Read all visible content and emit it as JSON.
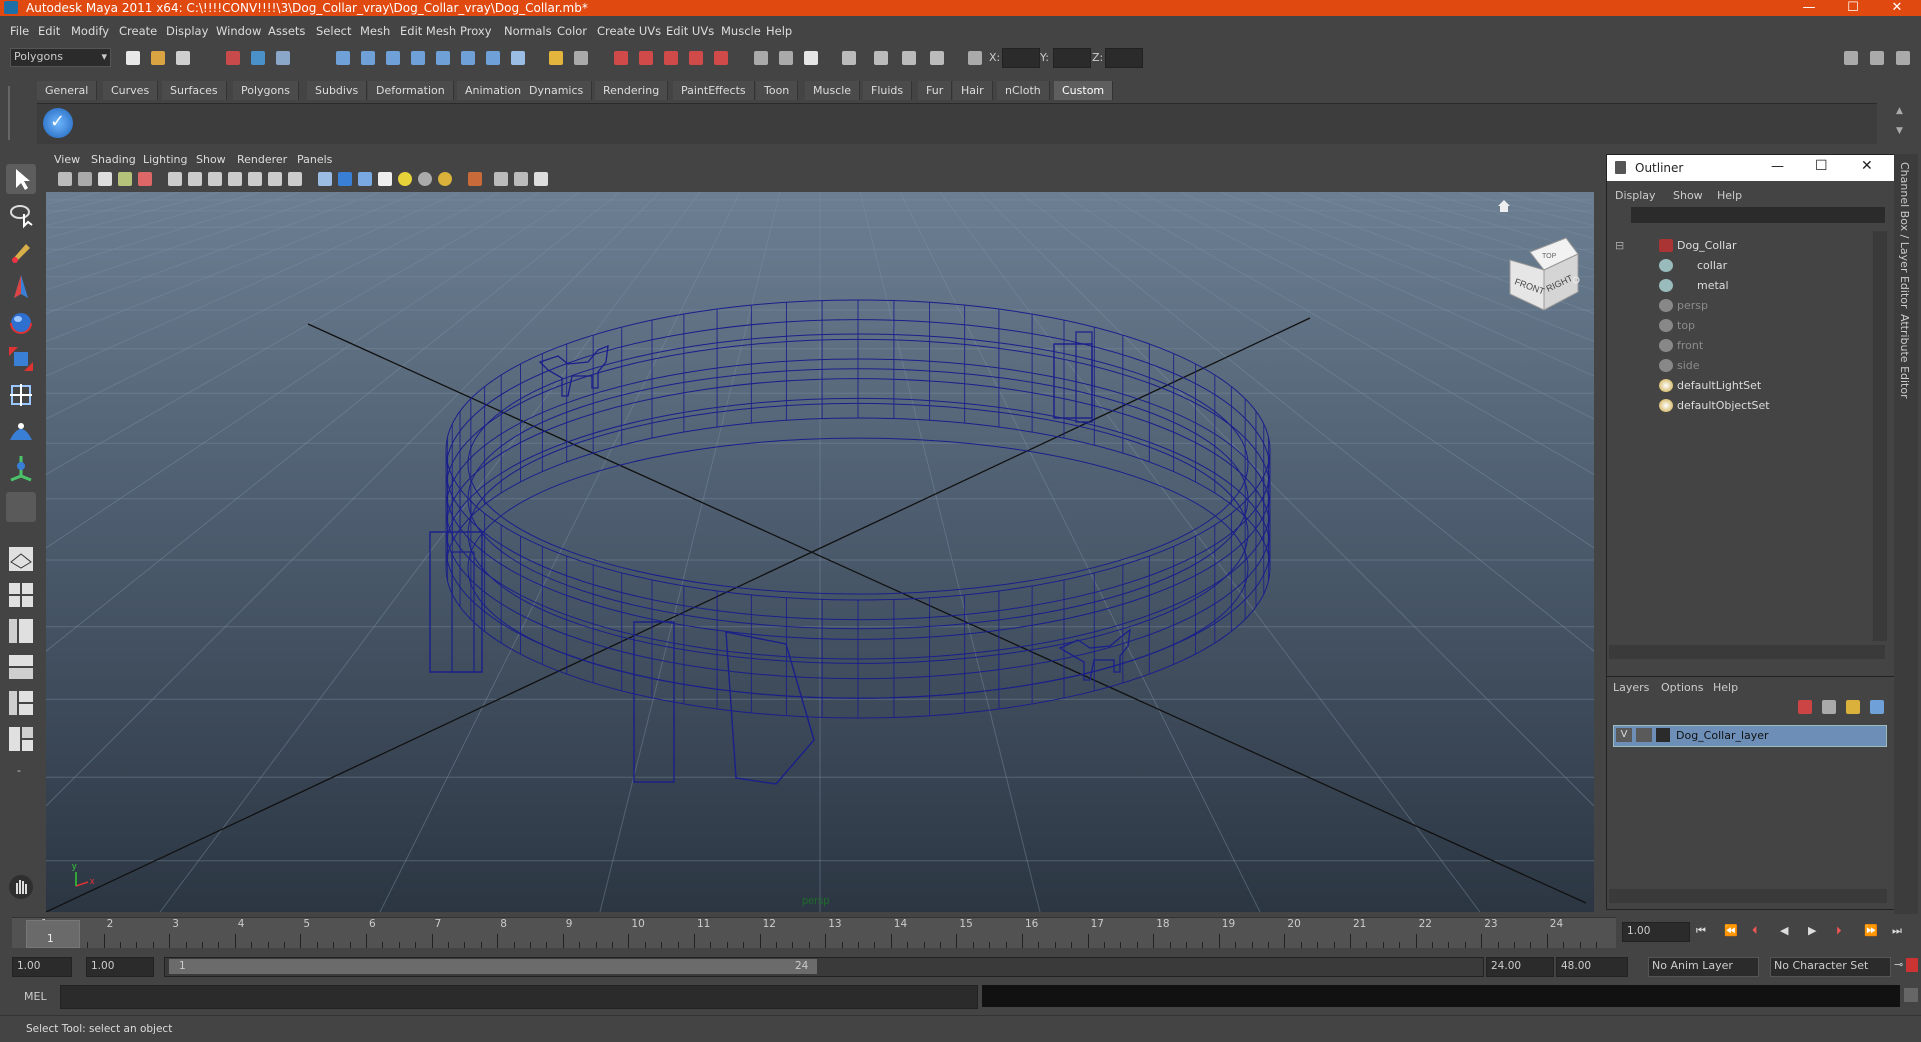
{
  "window": {
    "title": "Autodesk Maya 2011 x64: C:\\!!!!CONV!!!!\\3\\Dog_Collar_vray\\Dog_Collar_vray\\Dog_Collar.mb*",
    "minimize": "—",
    "maximize": "☐",
    "close": "✕"
  },
  "menus": [
    "File",
    "Edit",
    "Modify",
    "Create",
    "Display",
    "Window",
    "Assets",
    "Select",
    "Mesh",
    "Edit Mesh",
    "Proxy",
    "Normals",
    "Color",
    "Create UVs",
    "Edit UVs",
    "Muscle",
    "Help"
  ],
  "toolbar": {
    "mode_selector": "Polygons",
    "coord_x_label": "X:",
    "coord_y_label": "Y:",
    "coord_z_label": "Z:"
  },
  "shelf": {
    "tabs": [
      "General",
      "Curves",
      "Surfaces",
      "Polygons",
      "Subdivs",
      "Deformation",
      "Animation",
      "Dynamics",
      "Rendering",
      "PaintEffects",
      "Toon",
      "Muscle",
      "Fluids",
      "Fur",
      "Hair",
      "nCloth",
      "Custom"
    ],
    "active_tab": "Custom"
  },
  "viewport": {
    "menus": [
      "View",
      "Shading",
      "Lighting",
      "Show",
      "Renderer",
      "Panels"
    ],
    "camera_label": "persp",
    "viewcube_front": "FRONT",
    "viewcube_right": "RIGHT",
    "viewcube_top": "TOP",
    "axis_x": "x",
    "axis_y": "y",
    "wire_color": "#1a1f8a"
  },
  "outliner": {
    "title": "Outliner",
    "menus": [
      "Display",
      "Show",
      "Help"
    ],
    "items": [
      {
        "label": "Dog_Collar",
        "dim": false,
        "icon": "transform-icon"
      },
      {
        "label": "collar",
        "dim": false,
        "icon": "mesh-icon"
      },
      {
        "label": "metal",
        "dim": false,
        "icon": "mesh-icon"
      },
      {
        "label": "persp",
        "dim": true,
        "icon": "camera-icon"
      },
      {
        "label": "top",
        "dim": true,
        "icon": "camera-icon"
      },
      {
        "label": "front",
        "dim": true,
        "icon": "camera-icon"
      },
      {
        "label": "side",
        "dim": true,
        "icon": "camera-icon"
      },
      {
        "label": "defaultLightSet",
        "dim": false,
        "icon": "set-icon"
      },
      {
        "label": "defaultObjectSet",
        "dim": false,
        "icon": "set-icon"
      }
    ]
  },
  "layers": {
    "menus": [
      "Layers",
      "Options",
      "Help"
    ],
    "layer_name": "Dog_Collar_layer",
    "visibility": "V"
  },
  "side_tabs": [
    "Channel Box / Layer Editor",
    "Attribute Editor"
  ],
  "timeline": {
    "frames": [
      "1",
      "2",
      "3",
      "4",
      "5",
      "6",
      "7",
      "8",
      "9",
      "10",
      "11",
      "12",
      "13",
      "14",
      "15",
      "16",
      "17",
      "18",
      "19",
      "20",
      "21",
      "22",
      "23",
      "24"
    ],
    "current_frame": "1.00",
    "current_marker": "1"
  },
  "range": {
    "start": "1.00",
    "start2": "1.00",
    "slider_start": "1",
    "slider_end": "24",
    "end": "24.00",
    "end2": "48.00",
    "anim_layer": "No Anim Layer",
    "character_set": "No Character Set"
  },
  "command": {
    "label": "MEL"
  },
  "help_line": "Select Tool: select an object"
}
